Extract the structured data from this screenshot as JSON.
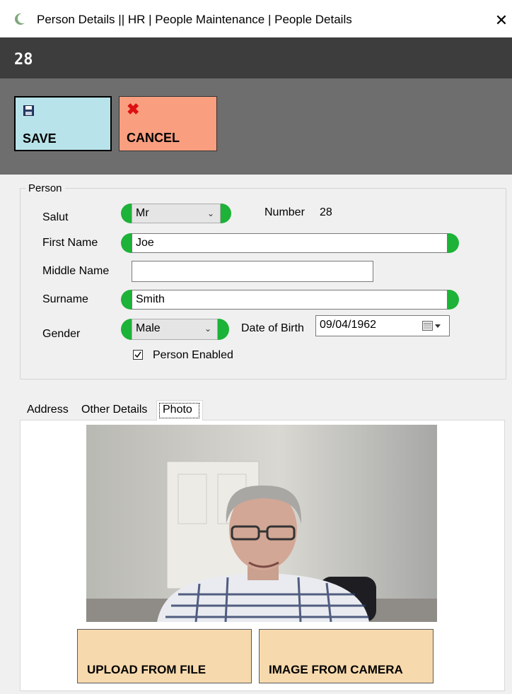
{
  "window": {
    "title": "Person Details || HR | People Maintenance | People Details",
    "close_glyph": "✕",
    "app_icon": "crescent-moon-icon"
  },
  "header": {
    "record_number": "28"
  },
  "toolbar": {
    "save_label": "SAVE",
    "cancel_label": "CANCEL",
    "save_color": "#b8e3ea",
    "cancel_color": "#f99f7f"
  },
  "person": {
    "group_title": "Person",
    "salutation": {
      "label": "Salut",
      "value": "Mr"
    },
    "number": {
      "label": "Number",
      "value": "28"
    },
    "first_name": {
      "label": "First Name",
      "value": "Joe"
    },
    "middle_name": {
      "label": "Middle Name",
      "value": ""
    },
    "surname": {
      "label": "Surname",
      "value": "Smith"
    },
    "gender": {
      "label": "Gender",
      "value": "Male"
    },
    "date_of_birth": {
      "label": "Date of Birth",
      "value": "09/04/1962"
    },
    "enabled": {
      "label": "Person Enabled",
      "checked": true
    },
    "required_color": "#1db238"
  },
  "tabs": [
    {
      "label": "Address",
      "selected": false
    },
    {
      "label": "Other Details",
      "selected": false
    },
    {
      "label": "Photo",
      "selected": true
    }
  ],
  "photo_tab": {
    "upload_label": "UPLOAD FROM FILE",
    "camera_label": "IMAGE FROM CAMERA",
    "button_color": "#f6d9ad"
  }
}
